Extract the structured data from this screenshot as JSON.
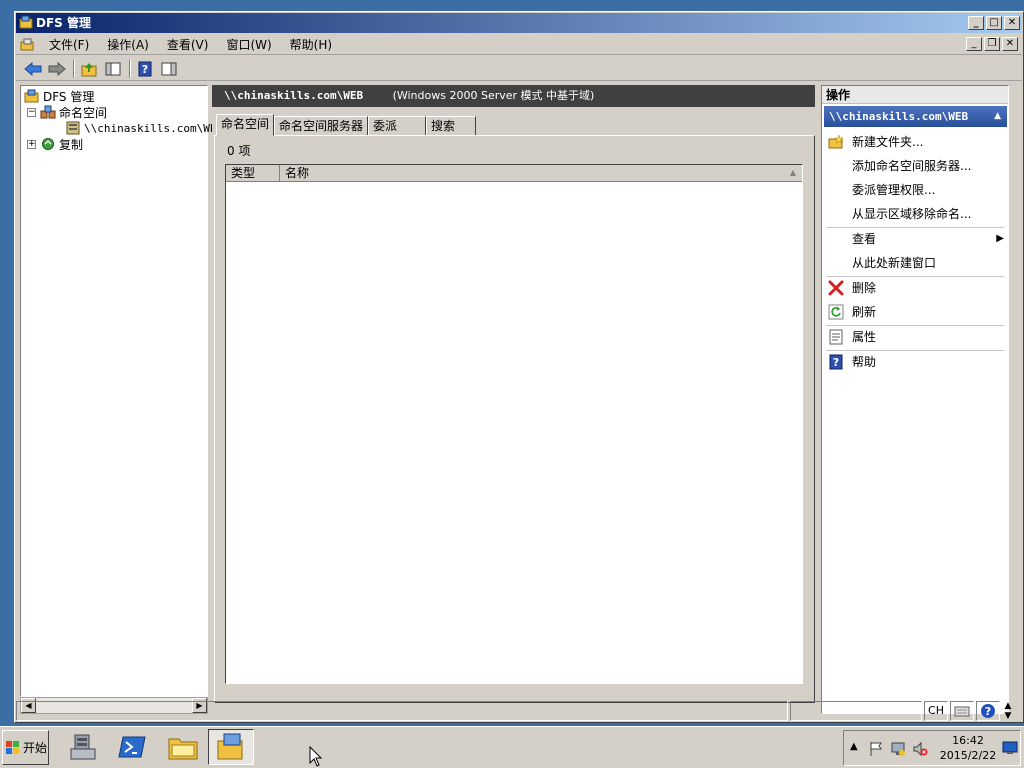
{
  "window": {
    "title": "DFS 管理"
  },
  "menubar": {
    "items": [
      "文件(F)",
      "操作(A)",
      "查看(V)",
      "窗口(W)",
      "帮助(H)"
    ]
  },
  "tree": {
    "root": "DFS 管理",
    "namespaces": "命名空间",
    "namespace_item": "\\\\chinaskills.com\\WEB",
    "replication": "复制"
  },
  "center": {
    "header_path": "\\\\chinaskills.com\\WEB",
    "header_mode": "(Windows 2000 Server 模式 中基于域)",
    "tabs": [
      "命名空间",
      "命名空间服务器",
      "委派",
      "搜索"
    ],
    "item_count": "0 项",
    "columns": [
      "类型",
      "名称"
    ]
  },
  "actions": {
    "header": "操作",
    "subheader": "\\\\chinaskills.com\\WEB",
    "items": [
      "新建文件夹...",
      "添加命名空间服务器...",
      "委派管理权限...",
      "从显示区域移除命名...",
      "查看",
      "从此处新建窗口",
      "删除",
      "刷新",
      "属性",
      "帮助"
    ]
  },
  "statusbar": {
    "lang": "CH"
  },
  "taskbar": {
    "start": "开始",
    "time": "16:42",
    "date": "2015/2/22"
  },
  "colors": {
    "titlebar_start": "#0a246a",
    "titlebar_end": "#a6caf0",
    "action_header": "#2a4f9a",
    "desktop": "#3a6ea5"
  }
}
